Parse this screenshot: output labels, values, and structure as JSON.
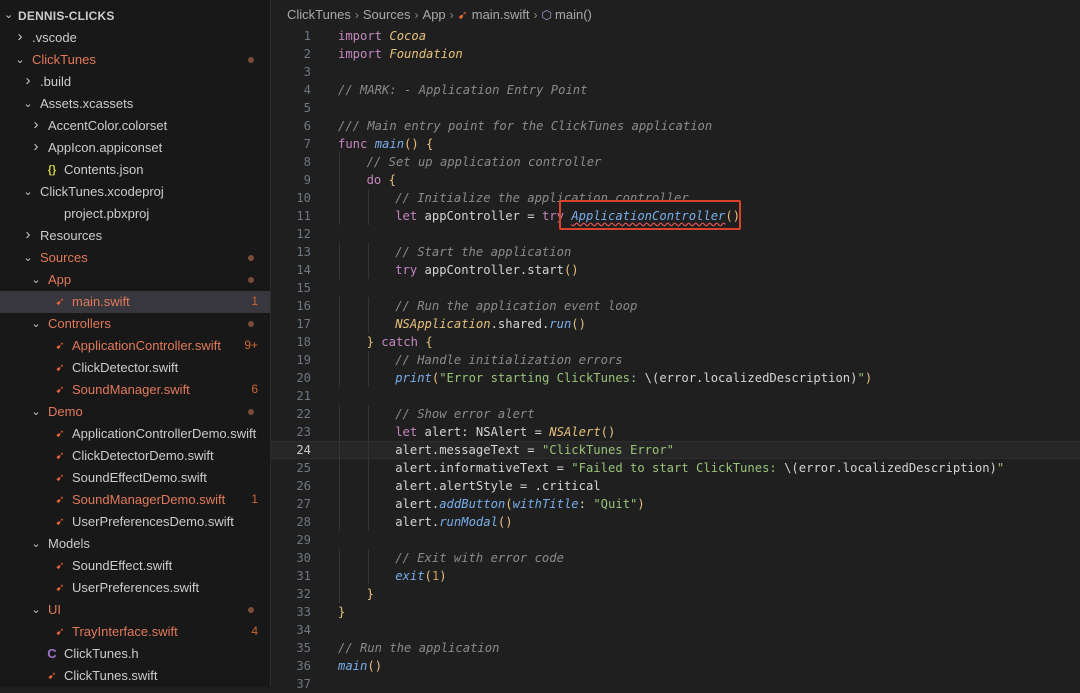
{
  "sidebar": {
    "title": "DENNIS-CLICKS",
    "items": [
      {
        "label": ".vscode",
        "kind": "folder",
        "expanded": false,
        "depth": 1
      },
      {
        "label": "ClickTunes",
        "kind": "folder",
        "expanded": true,
        "depth": 1,
        "modified": true,
        "dot": true
      },
      {
        "label": ".build",
        "kind": "folder",
        "expanded": false,
        "depth": 2
      },
      {
        "label": "Assets.xcassets",
        "kind": "folder",
        "expanded": true,
        "depth": 2
      },
      {
        "label": "AccentColor.colorset",
        "kind": "folder",
        "expanded": false,
        "depth": 3
      },
      {
        "label": "AppIcon.appiconset",
        "kind": "folder",
        "expanded": false,
        "depth": 3
      },
      {
        "label": "Contents.json",
        "kind": "json",
        "depth": 3
      },
      {
        "label": "ClickTunes.xcodeproj",
        "kind": "folder",
        "expanded": true,
        "depth": 2
      },
      {
        "label": "project.pbxproj",
        "kind": "file",
        "depth": 3
      },
      {
        "label": "Resources",
        "kind": "folder",
        "expanded": false,
        "depth": 2
      },
      {
        "label": "Sources",
        "kind": "folder",
        "expanded": true,
        "depth": 2,
        "modified": true,
        "dot": true
      },
      {
        "label": "App",
        "kind": "folder",
        "expanded": true,
        "depth": 3,
        "modified": true,
        "dot": true
      },
      {
        "label": "main.swift",
        "kind": "swift",
        "depth": 4,
        "modified": true,
        "badge": "1",
        "selected": true
      },
      {
        "label": "Controllers",
        "kind": "folder",
        "expanded": true,
        "depth": 3,
        "modified": true,
        "dot": true
      },
      {
        "label": "ApplicationController.swift",
        "kind": "swift",
        "depth": 4,
        "modified": true,
        "badge": "9+"
      },
      {
        "label": "ClickDetector.swift",
        "kind": "swift",
        "depth": 4
      },
      {
        "label": "SoundManager.swift",
        "kind": "swift",
        "depth": 4,
        "modified": true,
        "badge": "6"
      },
      {
        "label": "Demo",
        "kind": "folder",
        "expanded": true,
        "depth": 3,
        "modified": true,
        "dot": true
      },
      {
        "label": "ApplicationControllerDemo.swift",
        "kind": "swift",
        "depth": 4
      },
      {
        "label": "ClickDetectorDemo.swift",
        "kind": "swift",
        "depth": 4
      },
      {
        "label": "SoundEffectDemo.swift",
        "kind": "swift",
        "depth": 4
      },
      {
        "label": "SoundManagerDemo.swift",
        "kind": "swift",
        "depth": 4,
        "modified": true,
        "badge": "1"
      },
      {
        "label": "UserPreferencesDemo.swift",
        "kind": "swift",
        "depth": 4
      },
      {
        "label": "Models",
        "kind": "folder",
        "expanded": true,
        "depth": 3
      },
      {
        "label": "SoundEffect.swift",
        "kind": "swift",
        "depth": 4
      },
      {
        "label": "UserPreferences.swift",
        "kind": "swift",
        "depth": 4
      },
      {
        "label": "UI",
        "kind": "folder",
        "expanded": true,
        "depth": 3,
        "modified": true,
        "dot": true
      },
      {
        "label": "TrayInterface.swift",
        "kind": "swift",
        "depth": 4,
        "modified": true,
        "badge": "4"
      },
      {
        "label": "ClickTunes.h",
        "kind": "header",
        "depth": 3
      },
      {
        "label": "ClickTunes.swift",
        "kind": "swift",
        "depth": 3
      }
    ]
  },
  "breadcrumb": {
    "items": [
      "ClickTunes",
      "Sources",
      "App",
      "main.swift",
      "main()"
    ]
  },
  "editor": {
    "current_line": 24,
    "highlight_line": 11,
    "lines": [
      {
        "n": "1",
        "indent": 0,
        "tokens": [
          [
            "kw",
            "import "
          ],
          [
            "ty",
            "Cocoa"
          ]
        ]
      },
      {
        "n": "2",
        "indent": 0,
        "tokens": [
          [
            "kw",
            "import "
          ],
          [
            "ty",
            "Foundation"
          ]
        ]
      },
      {
        "n": "3",
        "indent": 0,
        "tokens": []
      },
      {
        "n": "4",
        "indent": 0,
        "tokens": [
          [
            "cm",
            "// MARK: - Application Entry Point"
          ]
        ]
      },
      {
        "n": "5",
        "indent": 0,
        "tokens": []
      },
      {
        "n": "6",
        "indent": 0,
        "tokens": [
          [
            "cm",
            "/// Main entry point for the ClickTunes application"
          ]
        ]
      },
      {
        "n": "7",
        "indent": 0,
        "tokens": [
          [
            "kw",
            "func "
          ],
          [
            "fn",
            "main"
          ],
          [
            "br",
            "() {"
          ]
        ]
      },
      {
        "n": "8",
        "indent": 1,
        "tokens": [
          [
            "cm",
            "// Set up application controller"
          ]
        ]
      },
      {
        "n": "9",
        "indent": 1,
        "tokens": [
          [
            "kw",
            "do "
          ],
          [
            "br",
            "{"
          ]
        ]
      },
      {
        "n": "10",
        "indent": 2,
        "tokens": [
          [
            "cm",
            "// Initialize the application controller"
          ]
        ]
      },
      {
        "n": "11",
        "indent": 2,
        "tokens": [
          [
            "kw",
            "let "
          ],
          [
            "id",
            "appController = "
          ],
          [
            "kw",
            "try "
          ],
          [
            "fnsq",
            "ApplicationController"
          ],
          [
            "br",
            "()"
          ]
        ]
      },
      {
        "n": "12",
        "indent": 0,
        "tokens": []
      },
      {
        "n": "13",
        "indent": 2,
        "tokens": [
          [
            "cm",
            "// Start the application"
          ]
        ]
      },
      {
        "n": "14",
        "indent": 2,
        "tokens": [
          [
            "kw",
            "try "
          ],
          [
            "id",
            "appController.start"
          ],
          [
            "br",
            "()"
          ]
        ]
      },
      {
        "n": "15",
        "indent": 0,
        "tokens": []
      },
      {
        "n": "16",
        "indent": 2,
        "tokens": [
          [
            "cm",
            "// Run the application event loop"
          ]
        ]
      },
      {
        "n": "17",
        "indent": 2,
        "tokens": [
          [
            "ty",
            "NSApplication"
          ],
          [
            "id",
            ".shared."
          ],
          [
            "fn",
            "run"
          ],
          [
            "br",
            "()"
          ]
        ]
      },
      {
        "n": "18",
        "indent": 1,
        "tokens": [
          [
            "br",
            "} "
          ],
          [
            "kw",
            "catch "
          ],
          [
            "br",
            "{"
          ]
        ]
      },
      {
        "n": "19",
        "indent": 2,
        "tokens": [
          [
            "cm",
            "// Handle initialization errors"
          ]
        ]
      },
      {
        "n": "20",
        "indent": 2,
        "tokens": [
          [
            "fn",
            "print"
          ],
          [
            "br",
            "("
          ],
          [
            "st",
            "\"Error starting ClickTunes: "
          ],
          [
            "id",
            "\\(error.localizedDescription)"
          ],
          [
            "st",
            "\""
          ],
          [
            "br",
            ")"
          ]
        ]
      },
      {
        "n": "21",
        "indent": 0,
        "tokens": []
      },
      {
        "n": "22",
        "indent": 2,
        "tokens": [
          [
            "cm",
            "// Show error alert"
          ]
        ]
      },
      {
        "n": "23",
        "indent": 2,
        "tokens": [
          [
            "kw",
            "let "
          ],
          [
            "id",
            "alert: NSAlert = "
          ],
          [
            "ty",
            "NSAlert"
          ],
          [
            "br",
            "()"
          ]
        ]
      },
      {
        "n": "24",
        "indent": 2,
        "tokens": [
          [
            "id",
            "alert.messageText = "
          ],
          [
            "st",
            "\"ClickTunes Error\""
          ]
        ]
      },
      {
        "n": "25",
        "indent": 2,
        "tokens": [
          [
            "id",
            "alert.informativeText = "
          ],
          [
            "st",
            "\"Failed to start ClickTunes: "
          ],
          [
            "id",
            "\\(error.localizedDescription)"
          ],
          [
            "st",
            "\""
          ]
        ]
      },
      {
        "n": "26",
        "indent": 2,
        "tokens": [
          [
            "id",
            "alert.alertStyle = .critical"
          ]
        ]
      },
      {
        "n": "27",
        "indent": 2,
        "tokens": [
          [
            "id",
            "alert."
          ],
          [
            "fn",
            "addButton"
          ],
          [
            "br",
            "("
          ],
          [
            "lb",
            "withTitle"
          ],
          [
            "id",
            ": "
          ],
          [
            "st",
            "\"Quit\""
          ],
          [
            "br",
            ")"
          ]
        ]
      },
      {
        "n": "28",
        "indent": 2,
        "tokens": [
          [
            "id",
            "alert."
          ],
          [
            "fn",
            "runModal"
          ],
          [
            "br",
            "()"
          ]
        ]
      },
      {
        "n": "29",
        "indent": 0,
        "tokens": []
      },
      {
        "n": "30",
        "indent": 2,
        "tokens": [
          [
            "cm",
            "// Exit with error code"
          ]
        ]
      },
      {
        "n": "31",
        "indent": 2,
        "tokens": [
          [
            "fn",
            "exit"
          ],
          [
            "br",
            "("
          ],
          [
            "nm",
            "1"
          ],
          [
            "br",
            ")"
          ]
        ]
      },
      {
        "n": "32",
        "indent": 1,
        "tokens": [
          [
            "br",
            "}"
          ]
        ]
      },
      {
        "n": "33",
        "indent": 0,
        "tokens": [
          [
            "br",
            "}"
          ]
        ]
      },
      {
        "n": "34",
        "indent": 0,
        "tokens": []
      },
      {
        "n": "35",
        "indent": 0,
        "tokens": [
          [
            "cm",
            "// Run the application"
          ]
        ]
      },
      {
        "n": "36",
        "indent": 0,
        "tokens": [
          [
            "fn",
            "main"
          ],
          [
            "br",
            "()"
          ]
        ]
      },
      {
        "n": "37",
        "indent": 0,
        "tokens": []
      }
    ]
  }
}
